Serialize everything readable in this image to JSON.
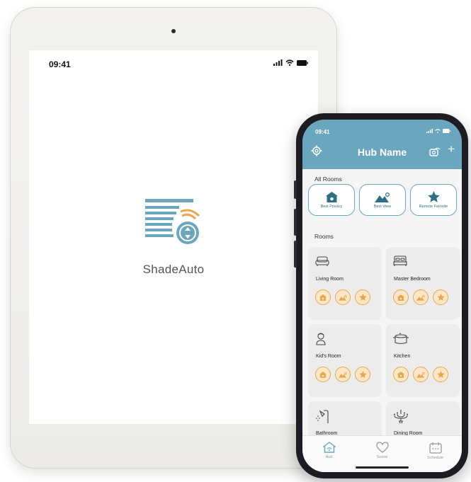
{
  "tablet": {
    "status": {
      "time": "09:41"
    },
    "brand": "ShadeAuto"
  },
  "phone": {
    "status": {
      "time": "09:41"
    },
    "header": {
      "title": "Hub Name",
      "add_label": "+"
    },
    "all_rooms": {
      "heading": "All Rooms",
      "scenes": [
        {
          "label": "Best Privacy",
          "icon": "house-icon"
        },
        {
          "label": "Best View",
          "icon": "mountain-icon"
        },
        {
          "label": "Remote Favorite",
          "icon": "star-icon"
        }
      ]
    },
    "rooms": {
      "heading": "Rooms",
      "items": [
        {
          "name": "Living Room",
          "icon": "sofa-icon"
        },
        {
          "name": "Master Bedroom",
          "icon": "bed-icon"
        },
        {
          "name": "Kid's Room",
          "icon": "child-icon"
        },
        {
          "name": "Kitchen",
          "icon": "pot-icon"
        },
        {
          "name": "Bathroom",
          "icon": "shower-icon"
        },
        {
          "name": "Dining Room",
          "icon": "chandelier-icon"
        }
      ]
    },
    "tabs": [
      {
        "label": "Hub",
        "icon": "hub-icon",
        "active": true
      },
      {
        "label": "Scene",
        "icon": "heart-icon",
        "active": false
      },
      {
        "label": "Schedule",
        "icon": "calendar-icon",
        "active": false
      }
    ],
    "colors": {
      "primary": "#6aa7bf",
      "accent": "#e8a74b"
    }
  }
}
